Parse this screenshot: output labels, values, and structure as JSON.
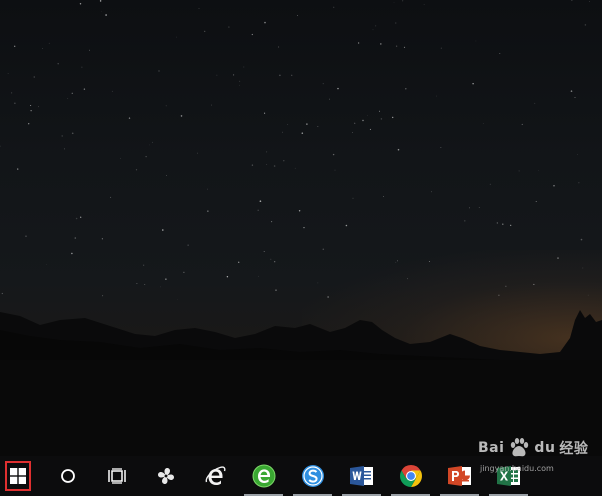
{
  "taskbar": {
    "items": [
      {
        "name": "start",
        "icon": "windows-logo-icon"
      },
      {
        "name": "search",
        "icon": "cortana-circle-icon"
      },
      {
        "name": "task-view",
        "icon": "task-view-icon"
      },
      {
        "name": "pinwheel-app",
        "icon": "pinwheel-icon"
      },
      {
        "name": "internet-explorer",
        "icon": "internet-explorer-icon"
      },
      {
        "name": "360-browser",
        "icon": "green-e-browser-icon"
      },
      {
        "name": "sogou-browser",
        "icon": "sogou-browser-icon"
      },
      {
        "name": "word",
        "icon": "word-icon"
      },
      {
        "name": "chrome",
        "icon": "chrome-icon"
      },
      {
        "name": "powerpoint",
        "icon": "powerpoint-icon"
      },
      {
        "name": "excel",
        "icon": "excel-icon"
      }
    ],
    "start_highlight_color": "#e03030"
  },
  "watermark": {
    "brand_latin": "Bai",
    "brand_du": "du",
    "brand_cn": "经验",
    "url": "jingyan.baidu.com"
  }
}
